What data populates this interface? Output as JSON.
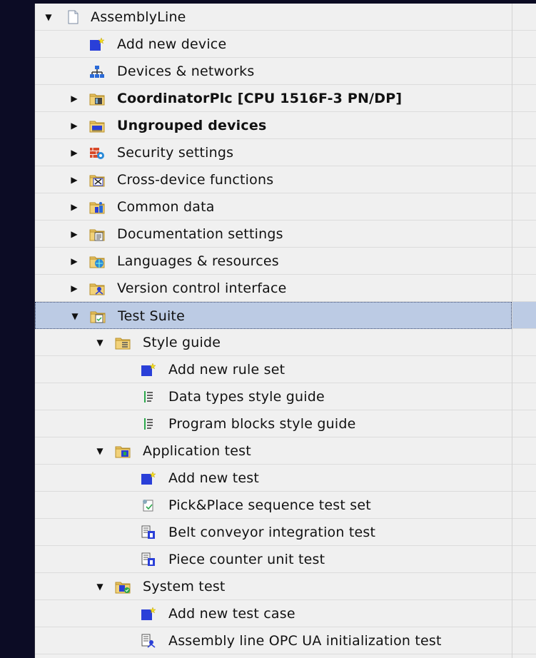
{
  "tree": {
    "items": [
      {
        "label": "AssemblyLine",
        "bold": false,
        "level": 0,
        "arrow": "down",
        "icon": "project-file-icon"
      },
      {
        "label": "Add new device",
        "bold": false,
        "level": 1,
        "arrow": "",
        "icon": "add-new-icon"
      },
      {
        "label": "Devices & networks",
        "bold": false,
        "level": 1,
        "arrow": "",
        "icon": "network-icon"
      },
      {
        "label": "CoordinatorPlc [CPU 1516F-3 PN/DP]",
        "bold": true,
        "level": 1,
        "arrow": "right",
        "icon": "plc-folder-icon"
      },
      {
        "label": "Ungrouped devices",
        "bold": true,
        "level": 1,
        "arrow": "right",
        "icon": "ungrouped-devices-icon"
      },
      {
        "label": "Security settings",
        "bold": false,
        "level": 1,
        "arrow": "right",
        "icon": "security-settings-icon"
      },
      {
        "label": "Cross-device functions",
        "bold": false,
        "level": 1,
        "arrow": "right",
        "icon": "cross-device-icon"
      },
      {
        "label": "Common data",
        "bold": false,
        "level": 1,
        "arrow": "right",
        "icon": "common-data-icon"
      },
      {
        "label": "Documentation settings",
        "bold": false,
        "level": 1,
        "arrow": "right",
        "icon": "documentation-icon"
      },
      {
        "label": "Languages & resources",
        "bold": false,
        "level": 1,
        "arrow": "right",
        "icon": "languages-icon"
      },
      {
        "label": "Version control interface",
        "bold": false,
        "level": 1,
        "arrow": "right",
        "icon": "version-control-icon"
      },
      {
        "label": "Test Suite",
        "bold": false,
        "level": 1,
        "arrow": "down",
        "icon": "test-suite-icon",
        "selected": true
      },
      {
        "label": "Style guide",
        "bold": false,
        "level": 2,
        "arrow": "down",
        "icon": "style-guide-folder-icon"
      },
      {
        "label": "Add new rule set",
        "bold": false,
        "level": 3,
        "arrow": "",
        "icon": "add-new-icon"
      },
      {
        "label": "Data types style guide",
        "bold": false,
        "level": 3,
        "arrow": "",
        "icon": "rule-set-icon"
      },
      {
        "label": "Program blocks style guide",
        "bold": false,
        "level": 3,
        "arrow": "",
        "icon": "rule-set-icon"
      },
      {
        "label": "Application test",
        "bold": false,
        "level": 2,
        "arrow": "down",
        "icon": "application-test-folder-icon"
      },
      {
        "label": "Add new test",
        "bold": false,
        "level": 3,
        "arrow": "",
        "icon": "add-new-icon"
      },
      {
        "label": "Pick&Place sequence test set",
        "bold": false,
        "level": 3,
        "arrow": "",
        "icon": "test-set-icon"
      },
      {
        "label": "Belt conveyor integration test",
        "bold": false,
        "level": 3,
        "arrow": "",
        "icon": "test-case-icon"
      },
      {
        "label": "Piece counter unit test",
        "bold": false,
        "level": 3,
        "arrow": "",
        "icon": "test-case-icon"
      },
      {
        "label": "System test",
        "bold": false,
        "level": 2,
        "arrow": "down",
        "icon": "system-test-folder-icon"
      },
      {
        "label": "Add new test case",
        "bold": false,
        "level": 3,
        "arrow": "",
        "icon": "add-new-icon"
      },
      {
        "label": "Assembly line OPC UA initialization test",
        "bold": false,
        "level": 3,
        "arrow": "",
        "icon": "system-test-case-icon"
      }
    ]
  },
  "colors": {
    "panel_bg": "#f0f0f0",
    "selection_bg": "#bccbe4",
    "folder_yellow": "#e8c260",
    "add_blue": "#2a3fd8",
    "star_yellow": "#f5e020"
  }
}
